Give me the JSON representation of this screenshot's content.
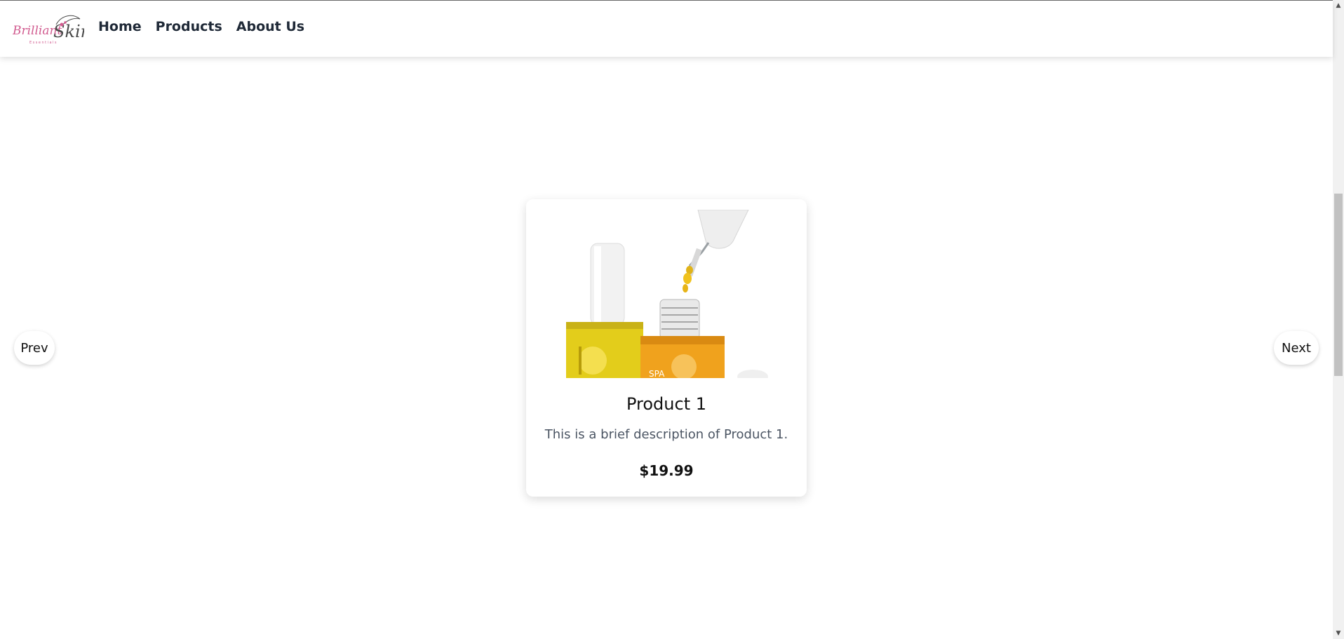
{
  "brand": {
    "logo_text": "BrilliantSkin",
    "logo_subtext": "Essentials",
    "logo_icon": "brand-logo-icon"
  },
  "nav": {
    "items": [
      {
        "label": "Home"
      },
      {
        "label": "Products"
      },
      {
        "label": "About Us"
      }
    ]
  },
  "carousel": {
    "prev_label": "Prev",
    "next_label": "Next"
  },
  "product": {
    "title": "Product 1",
    "description": "This is a brief description of Product 1.",
    "price": "$19.99",
    "image_icon": "serum-bottles-image"
  },
  "colors": {
    "nav_text": "#1f2937",
    "description_text": "#4b5563",
    "logo_pink": "#d15b8f",
    "bottle_yellow": "#e7c81a",
    "bottle_orange": "#f0a21d"
  }
}
